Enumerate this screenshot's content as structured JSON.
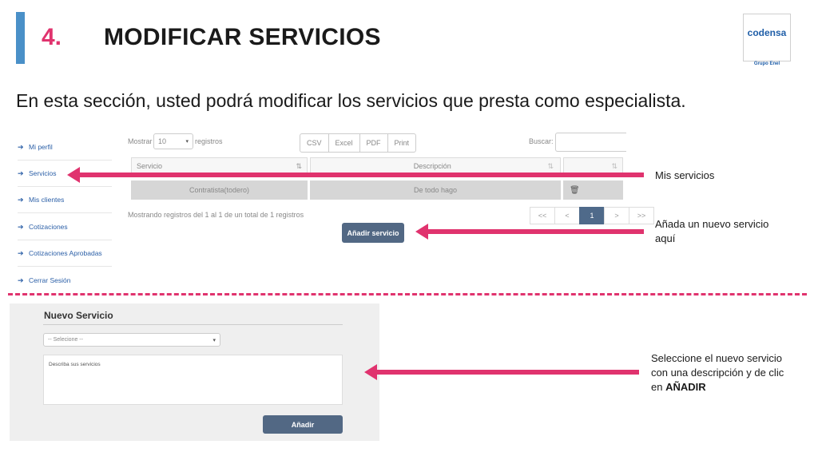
{
  "header": {
    "number": "4.",
    "title": "MODIFICAR SERVICIOS",
    "logo_text": "codensa",
    "logo_sub": "Grupo Enel"
  },
  "subtitle": "En esta sección, usted podrá modificar los servicios que presta como especialista.",
  "sidebar": {
    "items": [
      {
        "label": "Mi perfil"
      },
      {
        "label": "Servicios"
      },
      {
        "label": "Mis clientes"
      },
      {
        "label": "Cotizaciones"
      },
      {
        "label": "Cotizaciones Aprobadas"
      },
      {
        "label": "Cerrar Sesión"
      }
    ]
  },
  "table": {
    "show_label": "Mostrar",
    "show_value": "10",
    "records_label": "registros",
    "export_buttons": [
      "CSV",
      "Excel",
      "PDF",
      "Print"
    ],
    "search_label": "Buscar:",
    "columns": [
      "Servicio",
      "Descripción",
      ""
    ],
    "rows": [
      {
        "servicio": "Contratista(todero)",
        "descripcion": "De todo hago"
      }
    ],
    "info": "Mostrando registros del 1 al 1 de un total de 1 registros",
    "pagination": [
      "<<",
      "<",
      "1",
      ">",
      ">>"
    ],
    "add_button": "Añadir servicio"
  },
  "annotations": {
    "mis_servicios": "Mis servicios",
    "add_line1": "Añada un nuevo servicio",
    "add_line2": "aquí",
    "select_line1": "Seleccione el nuevo servicio",
    "select_line2": "con una descripción y de clic",
    "select_line3_prefix": "en ",
    "select_line3_bold": "AÑADIR"
  },
  "form": {
    "title": "Nuevo Servicio",
    "select_placeholder": "-- Selecione --",
    "textarea_placeholder": "Describa sus servicios",
    "submit_label": "Añadir"
  },
  "colors": {
    "accent": "#e0336e",
    "title_bar": "#4a90c8",
    "button": "#526884",
    "link": "#2b5fa7"
  }
}
